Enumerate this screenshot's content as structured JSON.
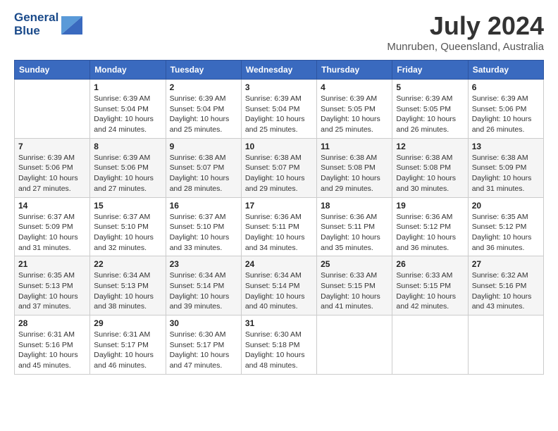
{
  "logo": {
    "line1": "General",
    "line2": "Blue"
  },
  "title": "July 2024",
  "subtitle": "Munruben, Queensland, Australia",
  "weekdays": [
    "Sunday",
    "Monday",
    "Tuesday",
    "Wednesday",
    "Thursday",
    "Friday",
    "Saturday"
  ],
  "weeks": [
    [
      {
        "day": "",
        "info": ""
      },
      {
        "day": "1",
        "info": "Sunrise: 6:39 AM\nSunset: 5:04 PM\nDaylight: 10 hours\nand 24 minutes."
      },
      {
        "day": "2",
        "info": "Sunrise: 6:39 AM\nSunset: 5:04 PM\nDaylight: 10 hours\nand 25 minutes."
      },
      {
        "day": "3",
        "info": "Sunrise: 6:39 AM\nSunset: 5:04 PM\nDaylight: 10 hours\nand 25 minutes."
      },
      {
        "day": "4",
        "info": "Sunrise: 6:39 AM\nSunset: 5:05 PM\nDaylight: 10 hours\nand 25 minutes."
      },
      {
        "day": "5",
        "info": "Sunrise: 6:39 AM\nSunset: 5:05 PM\nDaylight: 10 hours\nand 26 minutes."
      },
      {
        "day": "6",
        "info": "Sunrise: 6:39 AM\nSunset: 5:06 PM\nDaylight: 10 hours\nand 26 minutes."
      }
    ],
    [
      {
        "day": "7",
        "info": "Sunrise: 6:39 AM\nSunset: 5:06 PM\nDaylight: 10 hours\nand 27 minutes."
      },
      {
        "day": "8",
        "info": "Sunrise: 6:39 AM\nSunset: 5:06 PM\nDaylight: 10 hours\nand 27 minutes."
      },
      {
        "day": "9",
        "info": "Sunrise: 6:38 AM\nSunset: 5:07 PM\nDaylight: 10 hours\nand 28 minutes."
      },
      {
        "day": "10",
        "info": "Sunrise: 6:38 AM\nSunset: 5:07 PM\nDaylight: 10 hours\nand 29 minutes."
      },
      {
        "day": "11",
        "info": "Sunrise: 6:38 AM\nSunset: 5:08 PM\nDaylight: 10 hours\nand 29 minutes."
      },
      {
        "day": "12",
        "info": "Sunrise: 6:38 AM\nSunset: 5:08 PM\nDaylight: 10 hours\nand 30 minutes."
      },
      {
        "day": "13",
        "info": "Sunrise: 6:38 AM\nSunset: 5:09 PM\nDaylight: 10 hours\nand 31 minutes."
      }
    ],
    [
      {
        "day": "14",
        "info": "Sunrise: 6:37 AM\nSunset: 5:09 PM\nDaylight: 10 hours\nand 31 minutes."
      },
      {
        "day": "15",
        "info": "Sunrise: 6:37 AM\nSunset: 5:10 PM\nDaylight: 10 hours\nand 32 minutes."
      },
      {
        "day": "16",
        "info": "Sunrise: 6:37 AM\nSunset: 5:10 PM\nDaylight: 10 hours\nand 33 minutes."
      },
      {
        "day": "17",
        "info": "Sunrise: 6:36 AM\nSunset: 5:11 PM\nDaylight: 10 hours\nand 34 minutes."
      },
      {
        "day": "18",
        "info": "Sunrise: 6:36 AM\nSunset: 5:11 PM\nDaylight: 10 hours\nand 35 minutes."
      },
      {
        "day": "19",
        "info": "Sunrise: 6:36 AM\nSunset: 5:12 PM\nDaylight: 10 hours\nand 36 minutes."
      },
      {
        "day": "20",
        "info": "Sunrise: 6:35 AM\nSunset: 5:12 PM\nDaylight: 10 hours\nand 36 minutes."
      }
    ],
    [
      {
        "day": "21",
        "info": "Sunrise: 6:35 AM\nSunset: 5:13 PM\nDaylight: 10 hours\nand 37 minutes."
      },
      {
        "day": "22",
        "info": "Sunrise: 6:34 AM\nSunset: 5:13 PM\nDaylight: 10 hours\nand 38 minutes."
      },
      {
        "day": "23",
        "info": "Sunrise: 6:34 AM\nSunset: 5:14 PM\nDaylight: 10 hours\nand 39 minutes."
      },
      {
        "day": "24",
        "info": "Sunrise: 6:34 AM\nSunset: 5:14 PM\nDaylight: 10 hours\nand 40 minutes."
      },
      {
        "day": "25",
        "info": "Sunrise: 6:33 AM\nSunset: 5:15 PM\nDaylight: 10 hours\nand 41 minutes."
      },
      {
        "day": "26",
        "info": "Sunrise: 6:33 AM\nSunset: 5:15 PM\nDaylight: 10 hours\nand 42 minutes."
      },
      {
        "day": "27",
        "info": "Sunrise: 6:32 AM\nSunset: 5:16 PM\nDaylight: 10 hours\nand 43 minutes."
      }
    ],
    [
      {
        "day": "28",
        "info": "Sunrise: 6:31 AM\nSunset: 5:16 PM\nDaylight: 10 hours\nand 45 minutes."
      },
      {
        "day": "29",
        "info": "Sunrise: 6:31 AM\nSunset: 5:17 PM\nDaylight: 10 hours\nand 46 minutes."
      },
      {
        "day": "30",
        "info": "Sunrise: 6:30 AM\nSunset: 5:17 PM\nDaylight: 10 hours\nand 47 minutes."
      },
      {
        "day": "31",
        "info": "Sunrise: 6:30 AM\nSunset: 5:18 PM\nDaylight: 10 hours\nand 48 minutes."
      },
      {
        "day": "",
        "info": ""
      },
      {
        "day": "",
        "info": ""
      },
      {
        "day": "",
        "info": ""
      }
    ]
  ]
}
